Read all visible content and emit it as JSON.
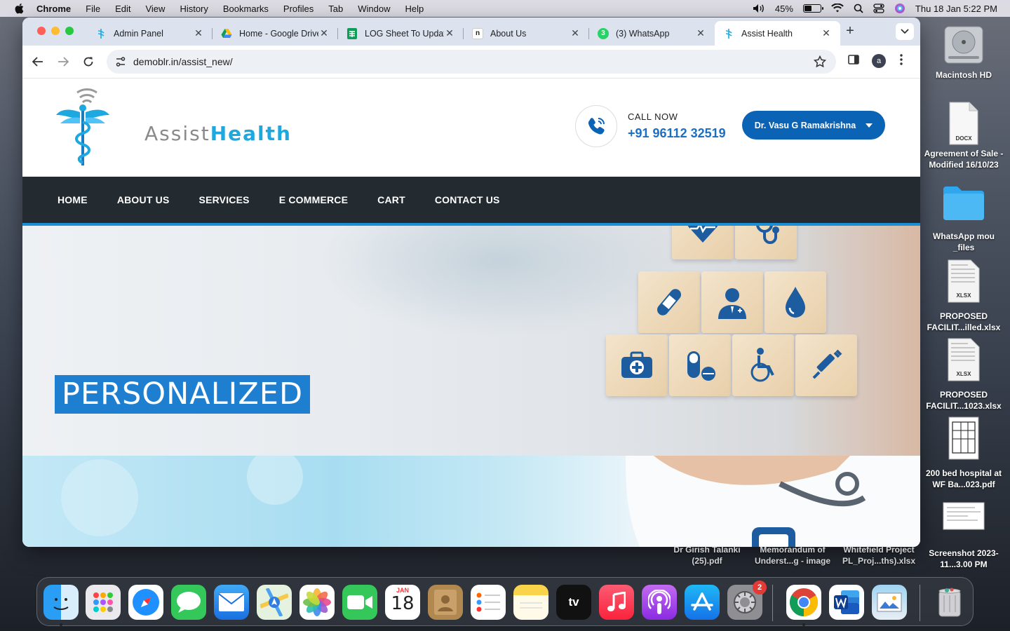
{
  "menubar": {
    "app_name": "Chrome",
    "items": [
      "File",
      "Edit",
      "View",
      "History",
      "Bookmarks",
      "Profiles",
      "Tab",
      "Window",
      "Help"
    ],
    "battery_percent": "45%",
    "datetime": "Thu 18 Jan  5:22 PM"
  },
  "browser": {
    "tabs": [
      {
        "title": "Admin Panel",
        "icon": "assist-health-favicon"
      },
      {
        "title": "Home - Google Drive",
        "icon": "google-drive-icon"
      },
      {
        "title": "LOG Sheet To Update",
        "icon": "google-sheets-icon"
      },
      {
        "title": "About Us",
        "icon": "n-favicon"
      },
      {
        "title": "(3) WhatsApp",
        "icon": "whatsapp-icon"
      },
      {
        "title": "Assist Health",
        "icon": "assist-health-favicon",
        "active": true
      }
    ],
    "url": "demoblr.in/assist_new/",
    "profile_initial": "a"
  },
  "site": {
    "logo": {
      "part1": "Assist",
      "part2": "Health"
    },
    "call_label": "CALL NOW",
    "call_number": "+91 96112 32519",
    "user_button": "Dr. Vasu G Ramakrishna",
    "nav": [
      "HOME",
      "ABOUT US",
      "SERVICES",
      "E COMMERCE",
      "CART",
      "CONTACT US"
    ],
    "hero_title": "PERSONALIZED",
    "colors": {
      "brand_blue": "#0b63b6",
      "nav_bg": "#232b31",
      "accent": "#1ea8e0"
    }
  },
  "desktop": {
    "items": [
      {
        "label": "Macintosh HD"
      },
      {
        "label": "Agreement of Sale - Modified 16/10/23"
      },
      {
        "label": "WhatsApp mou _files"
      },
      {
        "label": "PROPOSED FACILIT...illed.xlsx"
      },
      {
        "label": "PROPOSED FACILIT...1023.xlsx"
      },
      {
        "label": "200 bed hospital at WF Ba...023.pdf"
      },
      {
        "label": "Screenshot 2023-11...3.00 PM"
      }
    ],
    "below_window": [
      {
        "label": "Dr Girish Talanki (25).pdf"
      },
      {
        "label": "Memorandum of Underst...g - image"
      },
      {
        "label": "Whitefield Project PL_Proj...ths).xlsx"
      }
    ],
    "file_badges": {
      "docx": "DOCX",
      "xlsx": "XLSX"
    }
  },
  "dock": {
    "calendar_month": "JAN",
    "calendar_day": "18",
    "settings_badge": "2",
    "tv_label": "tv"
  }
}
